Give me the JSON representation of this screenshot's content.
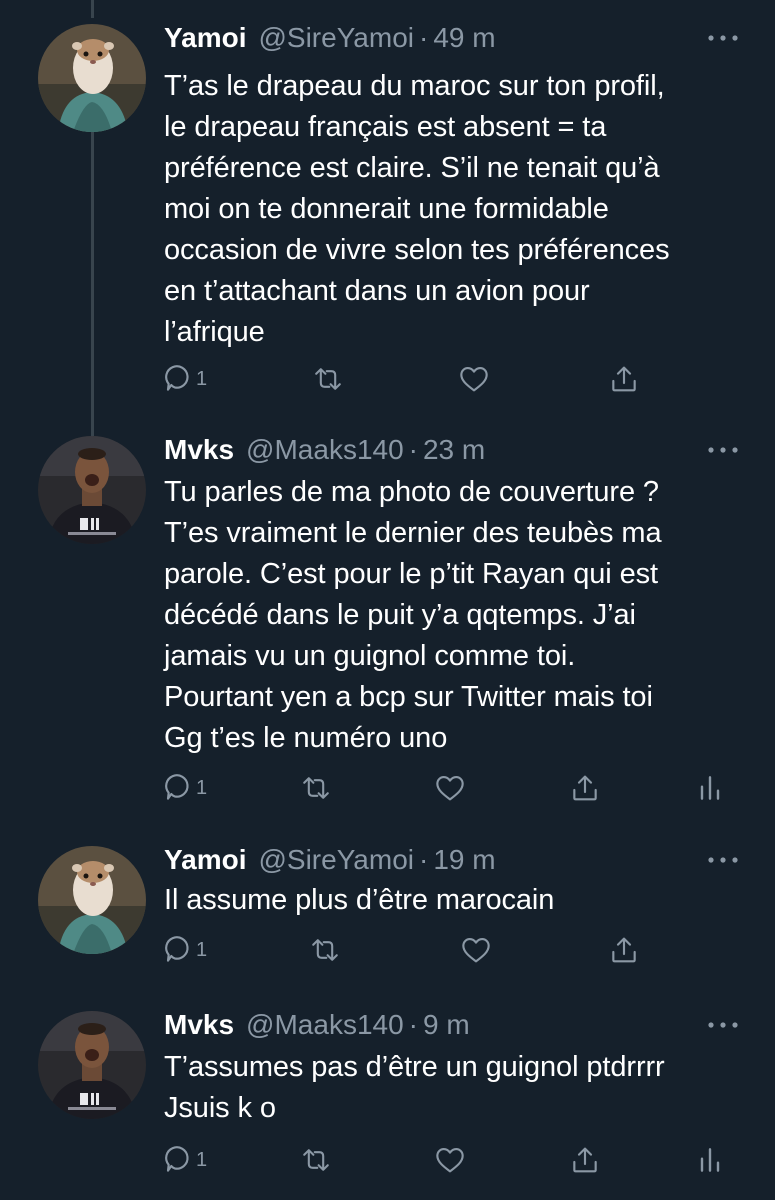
{
  "colors": {
    "background": "#15202b",
    "text": "#ffffff",
    "secondary": "#8b98a5",
    "thread_line": "#38444d"
  },
  "tweets": [
    {
      "name": "Yamoi",
      "handle": "@SireYamoi",
      "dot": "·",
      "time": "49 m",
      "avatar": "ferret-avatar",
      "text": "T’as le drapeau du maroc sur ton profil,\nle drapeau français est absent = ta\npréférence est claire. S’il ne tenait qu’à\nmoi on te donnerait une formidable\noccasion de vivre selon tes préférences\nen t’attachant dans un avion pour\nl’afrique",
      "reply_count": "1"
    },
    {
      "name": "Mvks",
      "handle": "@Maaks140",
      "dot": "·",
      "time": "23 m",
      "avatar": "footballer-avatar",
      "text": "Tu parles de ma photo de couverture ?\nT’es vraiment le dernier des teubès ma\nparole. C’est pour le p’tit Rayan qui est\ndécédé dans le puit y’a qqtemps. J’ai\njamais vu un guignol comme toi.\nPourtant yen a bcp sur Twitter mais toi\nGg t’es le numéro uno",
      "reply_count": "1"
    },
    {
      "name": "Yamoi",
      "handle": "@SireYamoi",
      "dot": "·",
      "time": "19 m",
      "avatar": "ferret-avatar",
      "text": "Il assume plus d’être marocain",
      "reply_count": "1"
    },
    {
      "name": "Mvks",
      "handle": "@Maaks140",
      "dot": "·",
      "time": "9 m",
      "avatar": "footballer-avatar",
      "text": "T’assumes pas d’être un guignol ptdrrrr\nJsuis k o",
      "reply_count": "1"
    }
  ]
}
